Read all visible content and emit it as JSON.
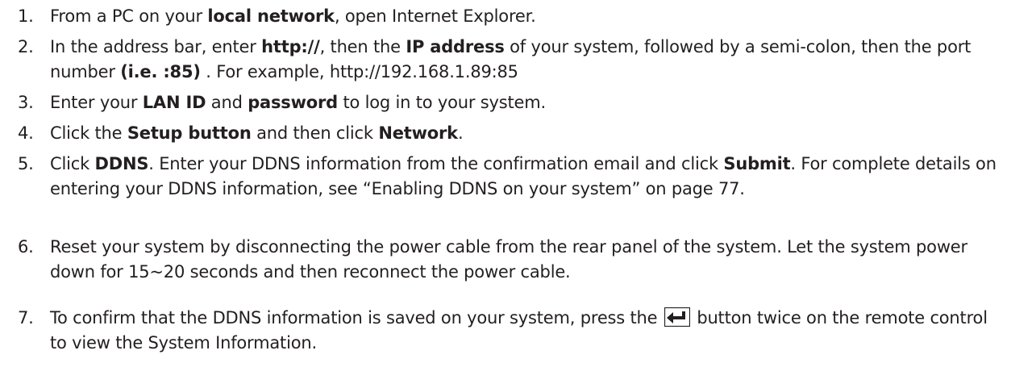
{
  "steps": [
    {
      "number": "1.",
      "parts": [
        "From a PC on your ",
        "local network",
        ", open Internet Explorer."
      ]
    },
    {
      "number": "2.",
      "parts": [
        "In the address bar, enter ",
        "http://",
        ", then the ",
        "IP address",
        " of your system, followed by a semi-colon, then the port number ",
        "(i.e. :85)",
        " . For example, http://192.168.1.89:85"
      ]
    },
    {
      "number": "3.",
      "parts": [
        "Enter your ",
        "LAN ID",
        " and ",
        "password",
        " to log in to your system."
      ]
    },
    {
      "number": "4.",
      "parts": [
        "Click the ",
        "Setup button",
        " and then click ",
        "Network",
        "."
      ]
    },
    {
      "number": "5.",
      "parts": [
        "Click ",
        "DDNS",
        ". Enter your DDNS information from the confirmation email and click ",
        "Submit",
        ". For complete details on entering your DDNS information, see “Enabling DDNS on your system” on page 77."
      ]
    },
    {
      "number": "6.",
      "parts": [
        "Reset your system by disconnecting the power cable from the rear panel of the system. Let the system power down for 15~20 seconds and then reconnect the power cable."
      ]
    },
    {
      "number": "7.",
      "parts": [
        "To confirm that the DDNS information is saved on your system, press the ",
        " button twice on the remote control to view the System Information."
      ],
      "icon": "enter-key-icon"
    }
  ]
}
